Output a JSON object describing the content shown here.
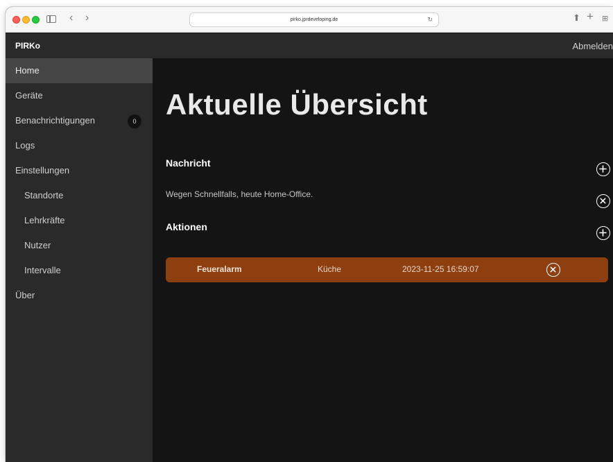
{
  "browser": {
    "url": "pirko.jprdeveloping.de",
    "icons": [
      "sidebar-toggle-icon",
      "back-icon",
      "forward-icon",
      "reload-icon",
      "share-icon",
      "new-tab-icon",
      "tab-overview-icon"
    ]
  },
  "header": {
    "brand": "PIRKo",
    "logout_label": "Abmelden"
  },
  "sidebar": {
    "items": [
      {
        "label": "Home",
        "active": true
      },
      {
        "label": "Geräte"
      },
      {
        "label": "Benachrichtigungen",
        "badge": "0"
      },
      {
        "label": "Logs"
      },
      {
        "label": "Einstellungen"
      },
      {
        "label": "Standorte",
        "sub": true
      },
      {
        "label": "Lehrkräfte",
        "sub": true
      },
      {
        "label": "Nutzer",
        "sub": true
      },
      {
        "label": "Intervalle",
        "sub": true
      },
      {
        "label": "Über"
      }
    ]
  },
  "main": {
    "title": "Aktuelle Übersicht",
    "message_section": {
      "title": "Nachricht",
      "text": "Wegen Schnellfalls, heute Home-Office."
    },
    "actions_section": {
      "title": "Aktionen",
      "rows": [
        {
          "name": "Feueralarm",
          "room": "Küche",
          "timestamp": "2023-11-25 16:59:07"
        }
      ]
    }
  },
  "colors": {
    "sidebar_bg": "#2a2a2a",
    "sidebar_active": "#464646",
    "main_bg": "#141414",
    "alarm_row": "#8d3f10"
  }
}
